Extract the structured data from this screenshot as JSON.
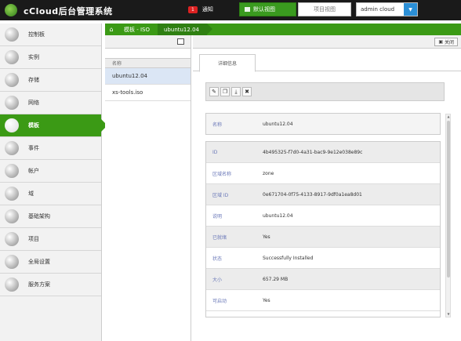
{
  "header": {
    "brand": "cCloud后台管理系统",
    "notice_badge": "1",
    "notice_label": "通知",
    "default_view": "默认视图",
    "project_view": "项目视图",
    "user": "admin cloud"
  },
  "sidebar": {
    "items": [
      {
        "label": "控制板"
      },
      {
        "label": "实例"
      },
      {
        "label": "存储"
      },
      {
        "label": "网络"
      },
      {
        "label": "模板"
      },
      {
        "label": "事件"
      },
      {
        "label": "帐户"
      },
      {
        "label": "域"
      },
      {
        "label": "基础架构"
      },
      {
        "label": "项目"
      },
      {
        "label": "全局设置"
      },
      {
        "label": "服务方案"
      }
    ]
  },
  "breadcrumb": {
    "templates": "模板 - ISO",
    "current": "ubuntu12.04"
  },
  "list": {
    "header": "名称",
    "rows": [
      "ubuntu12.04",
      "xs-tools.iso"
    ]
  },
  "detail": {
    "close_label": "关闭",
    "tab": "详细信息",
    "name_label": "名称",
    "name_value": "ubuntu12.04",
    "fields": [
      {
        "label": "ID",
        "value": "4b495325-f7d0-4a31-bac9-9e12e038e89c"
      },
      {
        "label": "区域名称",
        "value": "zone"
      },
      {
        "label": "区域 ID",
        "value": "0e671704-0f75-4133-8917-9df0a1ea8d01"
      },
      {
        "label": "说明",
        "value": "ubuntu12.04"
      },
      {
        "label": "已就绪",
        "value": "Yes"
      },
      {
        "label": "状态",
        "value": "Successfully Installed"
      },
      {
        "label": "大小",
        "value": "657.29 MB"
      },
      {
        "label": "可启动",
        "value": "Yes"
      }
    ]
  }
}
